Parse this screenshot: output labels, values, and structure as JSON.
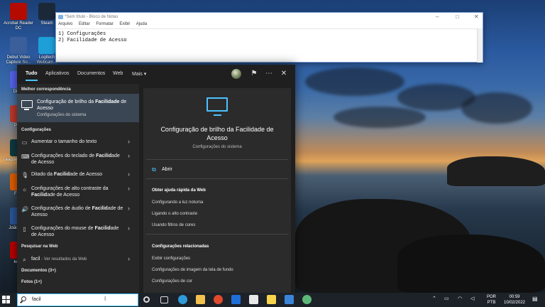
{
  "desktop": {
    "icons": [
      {
        "label": "Acrobat Reader DC",
        "color": "#b30b00",
        "icon": "acrobat-icon"
      },
      {
        "label": "Steam",
        "color": "#1b2838",
        "icon": "steam-icon"
      },
      {
        "label": "Debut Video Capture So...",
        "color": "#3a5f9a",
        "icon": "debut-icon"
      },
      {
        "label": "Logitech Webcam...",
        "color": "#1e9fd8",
        "icon": "logitech-icon"
      },
      {
        "label": "Disco",
        "color": "#5865f2",
        "icon": "discord-icon"
      },
      {
        "label": "PDF",
        "color": "#c0392b",
        "icon": "pdf-icon"
      },
      {
        "label": "League Legen...",
        "color": "#0e3b43",
        "icon": "league-icon"
      },
      {
        "label": "Firef",
        "color": "#e66000",
        "icon": "firefox-icon"
      },
      {
        "label": "João Pe...",
        "color": "#2b579a",
        "icon": "word-icon"
      },
      {
        "label": "kobo",
        "color": "#bf0000",
        "icon": "kobo-icon"
      }
    ]
  },
  "notepad": {
    "title": "*Sem título - Bloco de Notas",
    "menu": [
      "Arquivo",
      "Editar",
      "Formatar",
      "Exibir",
      "Ajuda"
    ],
    "lines": [
      "1) Configurações",
      "2) Facilidade de Acesso"
    ]
  },
  "search_panel": {
    "tabs": [
      "Tudo",
      "Aplicativos",
      "Documentos",
      "Web",
      "Mais ▾"
    ],
    "best_match_heading": "Melhor correspondência",
    "best_match": {
      "title_pre": "Configuração de brilho da ",
      "title_bold": "Facilidade",
      "title_post": " de Acesso",
      "subtitle": "Configurações do sistema"
    },
    "settings_heading": "Configurações",
    "settings": [
      {
        "icon": "▭",
        "pre": "Aumentar o tamanho do texto",
        "bold": "",
        "post": ""
      },
      {
        "icon": "⌨",
        "pre": "Configurações do teclado de ",
        "bold": "Facilid",
        "post": "ade de Acesso"
      },
      {
        "icon": "🎙",
        "pre": "Ditado da ",
        "bold": "Facilid",
        "post": "ade de Acesso"
      },
      {
        "icon": "☼",
        "pre": "Configurações de alto contraste da ",
        "bold": "Facilid",
        "post": "ade de Acesso"
      },
      {
        "icon": "🔊",
        "pre": "Configurações de áudio de ",
        "bold": "Facilid",
        "post": "ade de Acesso"
      },
      {
        "icon": "▯",
        "pre": "Configurações do mouse de ",
        "bold": "Facilid",
        "post": "ade de Acesso"
      }
    ],
    "web_heading": "Pesquisar na Web",
    "web_query": "facil",
    "web_suffix": " - Ver resultados da Web",
    "documents_heading": "Documentos (3+)",
    "photos_heading": "Fotos (1+)",
    "preview": {
      "title": "Configuração de brilho da Facilidade de Acesso",
      "subtitle": "Configurações do sistema",
      "open": "Abrir",
      "quick_help_heading": "Obter ajuda rápida da Web",
      "quick_help": [
        "Configurando a luz noturna",
        "Ligando o alto contraste",
        "Usando filtros de cores"
      ],
      "related_heading": "Configurações relacionadas",
      "related": [
        "Exibir configurações",
        "Configurações de imagem da tela de fundo",
        "Configurações de cor"
      ]
    }
  },
  "taskbar": {
    "search_text": "facil",
    "lang": [
      "POR",
      "PTB"
    ],
    "time": "00:59",
    "date": "10/02/2022"
  }
}
